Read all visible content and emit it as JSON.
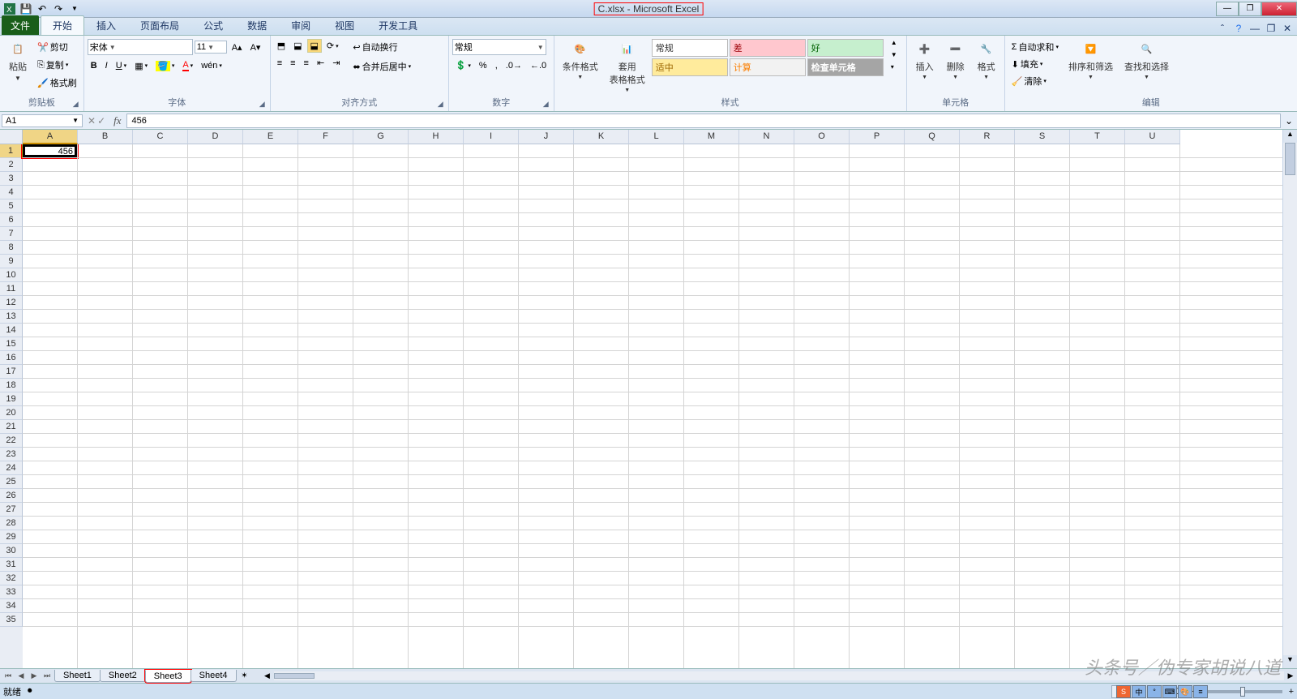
{
  "title": "C.xlsx - Microsoft Excel",
  "tabs": {
    "file": "文件",
    "home": "开始",
    "insert": "插入",
    "layout": "页面布局",
    "formulas": "公式",
    "data": "数据",
    "review": "审阅",
    "view": "视图",
    "dev": "开发工具"
  },
  "ribbon": {
    "clipboard": {
      "paste": "粘贴",
      "cut": "剪切",
      "copy": "复制",
      "painter": "格式刷",
      "label": "剪贴板"
    },
    "font": {
      "name": "宋体",
      "size": "11",
      "label": "字体"
    },
    "align": {
      "wrap": "自动换行",
      "merge": "合并后居中",
      "label": "对齐方式"
    },
    "number": {
      "format": "常规",
      "label": "数字"
    },
    "styles": {
      "cond": "条件格式",
      "table": "套用\n表格格式",
      "normal": "常规",
      "bad": "差",
      "good": "好",
      "neutral": "适中",
      "calc": "计算",
      "check": "检查单元格",
      "label": "样式"
    },
    "cells": {
      "insert": "插入",
      "delete": "删除",
      "format": "格式",
      "label": "单元格"
    },
    "editing": {
      "sum": "自动求和",
      "fill": "填充",
      "clear": "清除",
      "sort": "排序和筛选",
      "find": "查找和选择",
      "label": "编辑"
    }
  },
  "formulaBar": {
    "nameBox": "A1",
    "formula": "456"
  },
  "columns": [
    "A",
    "B",
    "C",
    "D",
    "E",
    "F",
    "G",
    "H",
    "I",
    "J",
    "K",
    "L",
    "M",
    "N",
    "O",
    "P",
    "Q",
    "R",
    "S",
    "T",
    "U"
  ],
  "rowCount": 35,
  "cellA1": "456",
  "sheets": {
    "s1": "Sheet1",
    "s2": "Sheet2",
    "s3": "Sheet3",
    "s4": "Sheet4"
  },
  "activeSheet": "Sheet3",
  "status": {
    "ready": "就绪",
    "zoom": "100%"
  },
  "watermark": "头条号／伪专家胡说八道",
  "ime": "中"
}
